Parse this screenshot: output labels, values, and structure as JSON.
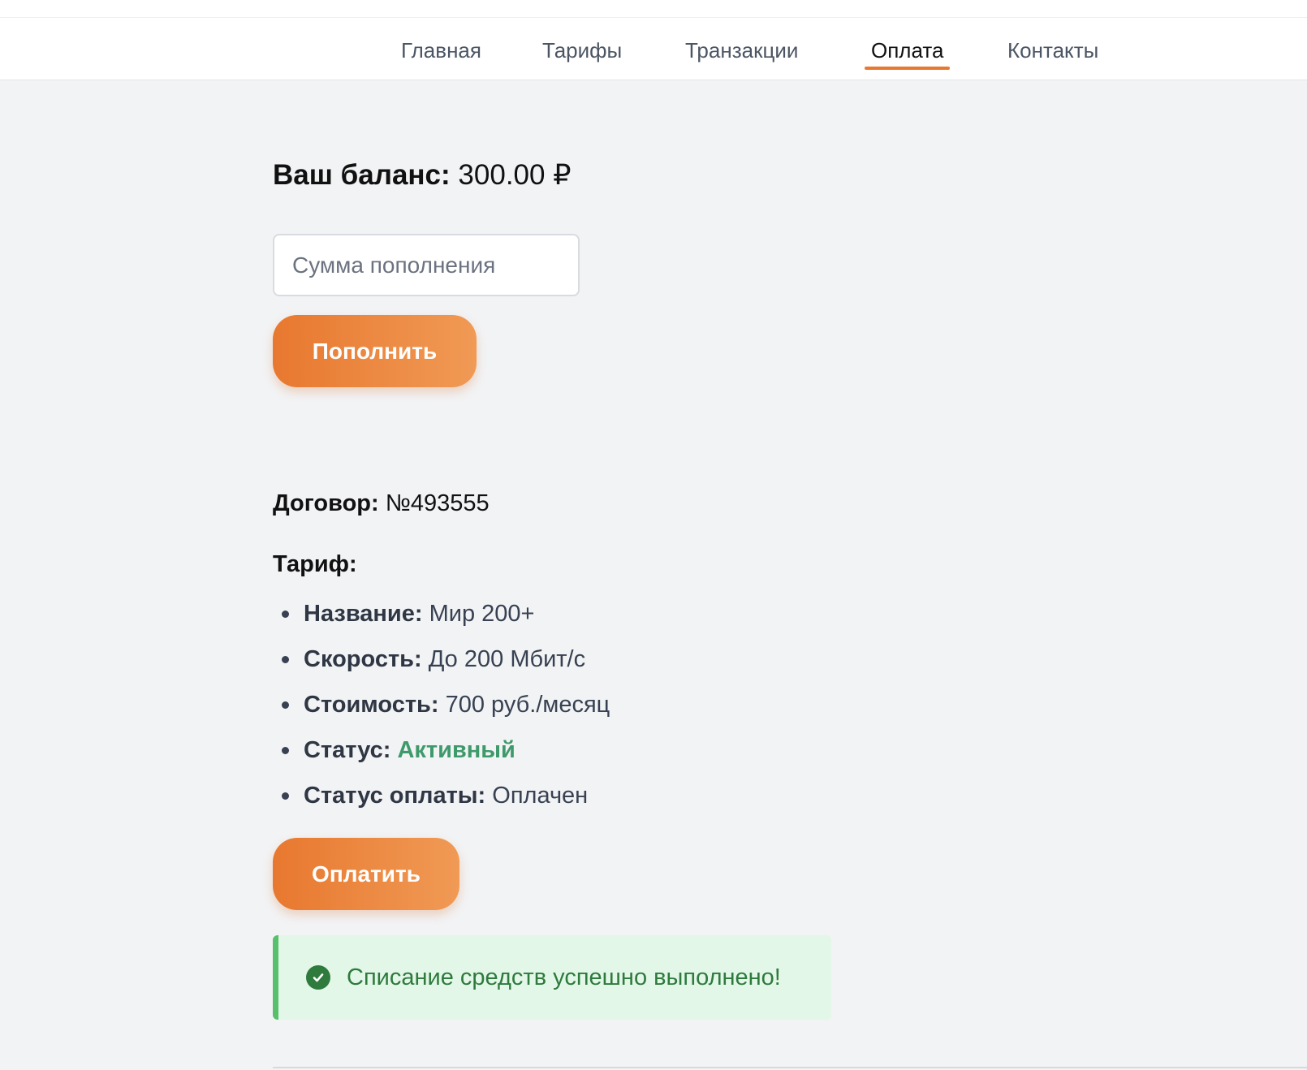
{
  "nav": {
    "items": [
      {
        "label": "Главная",
        "active": false
      },
      {
        "label": "Тарифы",
        "active": false
      },
      {
        "label": "Транзакции",
        "active": false
      },
      {
        "label": "Оплата",
        "active": true
      },
      {
        "label": "Контакты",
        "active": false
      }
    ]
  },
  "balance": {
    "label": "Ваш баланс:",
    "value": "300.00 ₽"
  },
  "topup": {
    "placeholder": "Сумма пополнения",
    "value": "",
    "button_label": "Пополнить"
  },
  "contract": {
    "label": "Договор:",
    "value": "№493555"
  },
  "tariff": {
    "heading": "Тариф:",
    "fields": [
      {
        "key": "Название:",
        "value": "Мир 200+"
      },
      {
        "key": "Скорость:",
        "value": "До 200 Мбит/с"
      },
      {
        "key": "Стоимость:",
        "value": "700 руб./месяц"
      },
      {
        "key": "Статус:",
        "value": "Активный"
      },
      {
        "key": "Статус оплаты:",
        "value": "Оплачен"
      }
    ]
  },
  "pay": {
    "button_label": "Оплатить"
  },
  "alert": {
    "icon": "check-circle-icon",
    "message": "Списание средств успешно выполнено!"
  },
  "colors": {
    "accent": "#e8782f",
    "accent_light": "#f09a55",
    "status_active": "#3f9a6b",
    "alert_bg": "#e2f7e8",
    "alert_border": "#56c06a",
    "alert_text": "#2f7a3d",
    "page_bg": "#f2f3f5"
  }
}
